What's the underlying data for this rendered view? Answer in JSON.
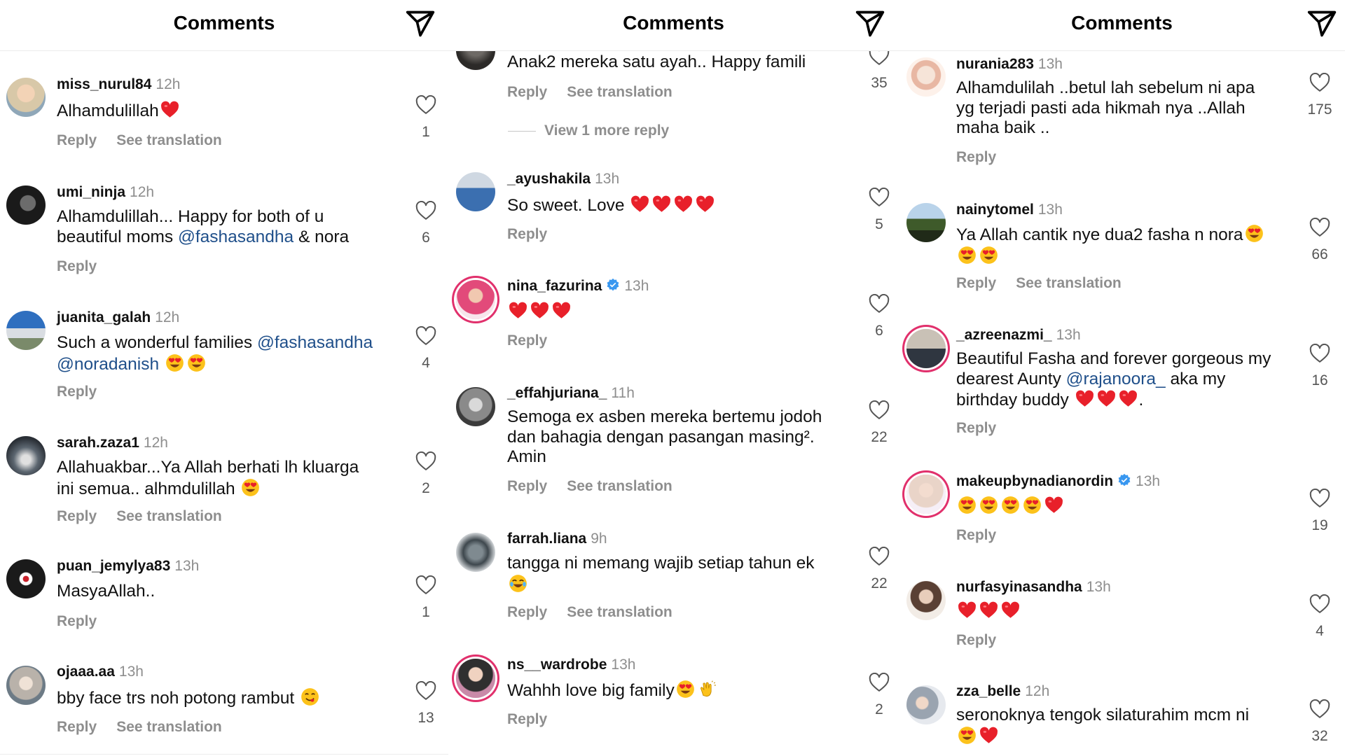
{
  "panels": [
    {
      "title": "Comments",
      "comments": [
        {
          "username": "miss_nurul84",
          "time": "12h",
          "lines": [
            "Alhamdulillah"
          ],
          "emoji": [
            "heart"
          ],
          "actions": [
            "Reply",
            "See translation"
          ],
          "likes": "1"
        },
        {
          "username": "umi_ninja",
          "time": "12h",
          "lines": [
            "Alhamdulillah... Happy for both of u",
            "beautiful moms"
          ],
          "mention": "@fashasandha",
          "suffix": "& nora",
          "actions": [
            "Reply"
          ],
          "likes": "6"
        },
        {
          "username": "juanita_galah",
          "time": "12h",
          "lines": [
            "Such a wonderful families"
          ],
          "mentions": [
            "@fashasandha",
            "@noradanish"
          ],
          "emoji": [
            "heart-eyes",
            "heart-eyes"
          ],
          "actions": [
            "Reply"
          ],
          "likes": "4"
        },
        {
          "username": "sarah.zaza1",
          "time": "12h",
          "lines": [
            "Allahuakbar...Ya Allah berhati lh kluarga",
            "ini semua.. alhmdulillah"
          ],
          "emoji": [
            "heart-eyes"
          ],
          "actions": [
            "Reply",
            "See translation"
          ],
          "likes": "2"
        },
        {
          "username": "puan_jemylya83",
          "time": "13h",
          "lines": [
            "MasyaAllah.."
          ],
          "actions": [
            "Reply"
          ],
          "likes": "1"
        },
        {
          "username": "ojaaa.aa",
          "time": "13h",
          "lines": [
            "bby face trs noh potong rambut"
          ],
          "emoji": [
            "yum"
          ],
          "actions": [
            "Reply",
            "See translation"
          ],
          "likes": "13"
        }
      ]
    },
    {
      "title": "Comments",
      "partial": {
        "text": "Anak2 mereka satu ayah.. Happy famili",
        "actions": [
          "Reply",
          "See translation"
        ],
        "likes": "35",
        "view_more": "View 1 more reply"
      },
      "comments": [
        {
          "username": "_ayushakila",
          "time": "13h",
          "lines": [
            "So sweet. Love"
          ],
          "emoji": [
            "heart",
            "heart",
            "heart",
            "heart"
          ],
          "actions": [
            "Reply"
          ],
          "likes": "5"
        },
        {
          "username": "nina_fazurina",
          "time": "13h",
          "verified": true,
          "lines": [
            ""
          ],
          "emoji": [
            "heart",
            "heart",
            "heart"
          ],
          "actions": [
            "Reply"
          ],
          "likes": "6"
        },
        {
          "username": "_effahjuriana_",
          "time": "11h",
          "lines": [
            "Semoga ex asben mereka bertemu jodoh",
            "dan bahagia dengan pasangan masing².",
            "Amin"
          ],
          "actions": [
            "Reply",
            "See translation"
          ],
          "likes": "22"
        },
        {
          "username": "farrah.liana",
          "time": "9h",
          "lines": [
            "tangga ni memang wajib setiap tahun ek"
          ],
          "emoji": [
            "joy"
          ],
          "actions": [
            "Reply",
            "See translation"
          ],
          "likes": "22"
        },
        {
          "username": "ns__wardrobe",
          "time": "13h",
          "lines": [
            "Wahhh love big family"
          ],
          "emoji": [
            "heart-eyes",
            "clap"
          ],
          "actions": [
            "Reply"
          ],
          "likes": "2"
        }
      ]
    },
    {
      "title": "Comments",
      "comments": [
        {
          "username": "nurania283",
          "time": "13h",
          "lines": [
            "Alhamdulilah ..betul lah sebelum ni apa",
            "yg terjadi pasti ada hikmah nya ..Allah",
            "maha baik .."
          ],
          "actions": [
            "Reply"
          ],
          "likes": "175"
        },
        {
          "username": "nainytomel",
          "time": "13h",
          "lines": [
            "Ya Allah cantik nye dua2 fasha n nora"
          ],
          "emoji": [
            "heart-eyes",
            "heart-eyes",
            "heart-eyes"
          ],
          "actions": [
            "Reply",
            "See translation"
          ],
          "likes": "66"
        },
        {
          "username": "_azreenazmi_",
          "time": "13h",
          "lines": [
            "Beautiful Fasha and forever gorgeous my",
            "dearest Aunty",
            "aka my",
            "birthday buddy"
          ],
          "mention": "@rajanoora_",
          "emoji": [
            "heart",
            "heart",
            "heart"
          ],
          "actions": [
            "Reply"
          ],
          "likes": "16"
        },
        {
          "username": "makeupbynadianordin",
          "time": "13h",
          "verified": true,
          "lines": [
            ""
          ],
          "emoji": [
            "heart-eyes",
            "heart-eyes",
            "heart-eyes",
            "heart-eyes",
            "heart"
          ],
          "actions": [
            "Reply"
          ],
          "likes": "19"
        },
        {
          "username": "nurfasyinasandha",
          "time": "13h",
          "lines": [
            ""
          ],
          "emoji": [
            "heart",
            "heart",
            "heart"
          ],
          "actions": [
            "Reply"
          ],
          "likes": "4"
        },
        {
          "username": "zza_belle",
          "time": "12h",
          "lines": [
            "seronoknya tengok silaturahim mcm ni"
          ],
          "emoji": [
            "heart-eyes",
            "heart"
          ],
          "likes": "32"
        }
      ]
    }
  ],
  "colors": {
    "mention": "#1f4f8a",
    "meta": "#8e8e8e",
    "heart_red": "#e8202a",
    "verified": "#3897f0",
    "story_ring": "#e1306c"
  },
  "icons": [
    "send-icon",
    "heart-outline-icon",
    "verified-badge-icon"
  ]
}
